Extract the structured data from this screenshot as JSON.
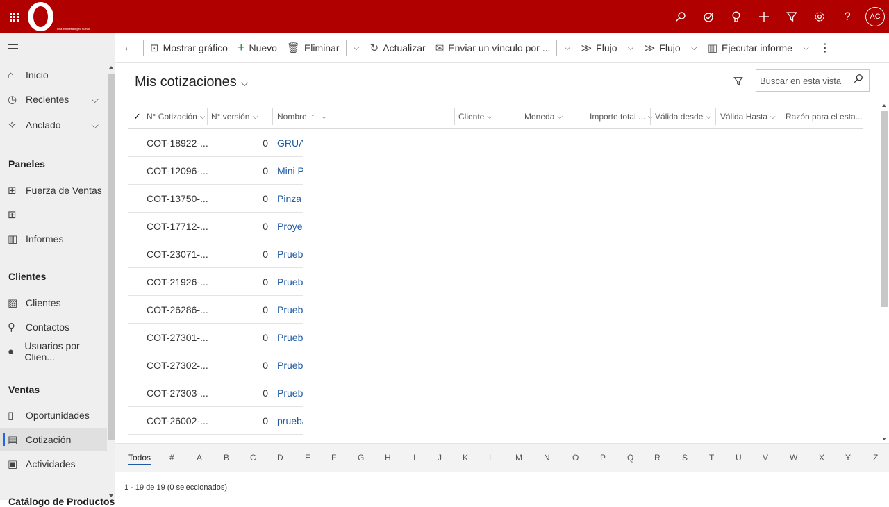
{
  "topbar": {
    "logo_tagline": "Una empresa ingeo nuevo",
    "avatar": "AC",
    "icons": [
      "search-icon",
      "task-icon",
      "lightbulb-icon",
      "plus-icon",
      "filter-icon",
      "settings-icon",
      "help-icon"
    ]
  },
  "sidebar": {
    "items": [
      {
        "label": "Inicio",
        "icon": "home-icon"
      },
      {
        "label": "Recientes",
        "icon": "clock-icon"
      },
      {
        "label": "Anclado",
        "icon": "pin-icon"
      }
    ],
    "groups": [
      {
        "title": "Paneles",
        "items": [
          {
            "label": "Fuerza de Ventas",
            "icon": "dashboard-icon"
          },
          {
            "label": "",
            "icon": "dashboard-icon"
          },
          {
            "label": "Informes",
            "icon": "report-icon"
          }
        ]
      },
      {
        "title": "Clientes",
        "items": [
          {
            "label": "Clientes",
            "icon": "account-icon"
          },
          {
            "label": "Contactos",
            "icon": "person-icon"
          },
          {
            "label": "Usuarios por Clien...",
            "icon": "user-icon"
          }
        ]
      },
      {
        "title": "Ventas",
        "items": [
          {
            "label": "Oportunidades",
            "icon": "opportunity-icon"
          },
          {
            "label": "Cotización",
            "icon": "quote-icon"
          },
          {
            "label": "Actividades",
            "icon": "activity-icon"
          }
        ]
      }
    ],
    "bottom_partial": "Catálogo de Productos"
  },
  "commandbar": {
    "show_chart": "Mostrar gráfico",
    "new": "Nuevo",
    "delete": "Eliminar",
    "refresh": "Actualizar",
    "email_link": "Enviar un vínculo por ...",
    "flow1": "Flujo",
    "flow2": "Flujo",
    "run_report": "Ejecutar informe"
  },
  "view": {
    "title": "Mis cotizaciones",
    "search_placeholder": "Buscar en esta vista"
  },
  "columns": [
    "N° Cotización",
    "N° versión",
    "Nombre",
    "Cliente",
    "Moneda",
    "Importe total ...",
    "Válida desde",
    "Válida Hasta",
    "Razón para el esta..."
  ],
  "rows": [
    {
      "num": "COT-18922-...",
      "ver": "0",
      "name": "GRUA HIDRAULICA"
    },
    {
      "num": "COT-12096-...",
      "ver": "0",
      "name": "Mini Pulidora"
    },
    {
      "num": "COT-13750-...",
      "ver": "0",
      "name": "Pinza Tuerca"
    },
    {
      "num": "COT-17712-...",
      "ver": "0",
      "name": "Proyecto"
    },
    {
      "num": "COT-23071-...",
      "ver": "0",
      "name": "Prueba"
    },
    {
      "num": "COT-21926-...",
      "ver": "0",
      "name": "Prueba"
    },
    {
      "num": "COT-26286-...",
      "ver": "0",
      "name": "Prueba"
    },
    {
      "num": "COT-27301-...",
      "ver": "0",
      "name": "Prueba"
    },
    {
      "num": "COT-27302-...",
      "ver": "0",
      "name": "Prueba"
    },
    {
      "num": "COT-27303-...",
      "ver": "0",
      "name": "Prueba"
    },
    {
      "num": "COT-26002-...",
      "ver": "0",
      "name": "prueba"
    }
  ],
  "alphabet": [
    "Todos",
    "#",
    "A",
    "B",
    "C",
    "D",
    "E",
    "F",
    "G",
    "H",
    "I",
    "J",
    "K",
    "L",
    "M",
    "N",
    "O",
    "P",
    "Q",
    "R",
    "S",
    "T",
    "U",
    "V",
    "W",
    "X",
    "Y",
    "Z"
  ],
  "footer": "1 - 19 de 19 (0 seleccionados)"
}
